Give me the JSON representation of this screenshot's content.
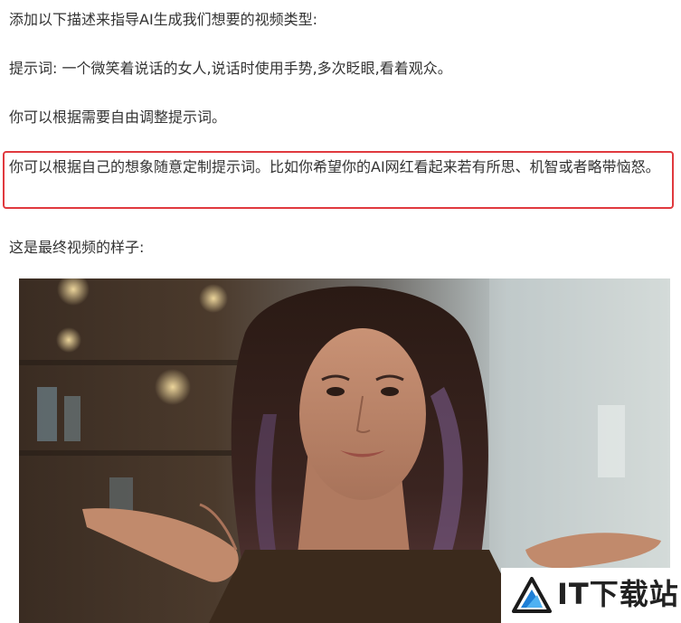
{
  "article": {
    "paragraph_1": "添加以下描述来指导AI生成我们想要的视频类型:",
    "paragraph_2": "提示词: 一个微笑着说话的女人,说话时使用手势,多次眨眼,看着观众。",
    "paragraph_3": "你可以根据需要自由调整提示词。",
    "highlighted_paragraph": "你可以根据自己的想象随意定制提示词。比如你希望你的AI网红看起来若有所思、机智或者略带恼怒。",
    "paragraph_5": "这是最终视频的样子:"
  },
  "image": {
    "description_icon": "photo-woman-shrugging"
  },
  "watermark": {
    "text": "IT下载站",
    "logo_icon": "triangle-logo-icon"
  },
  "colors": {
    "highlight_border": "#e0393e",
    "body_text": "#333333",
    "logo_blue": "#1e7fd6"
  }
}
